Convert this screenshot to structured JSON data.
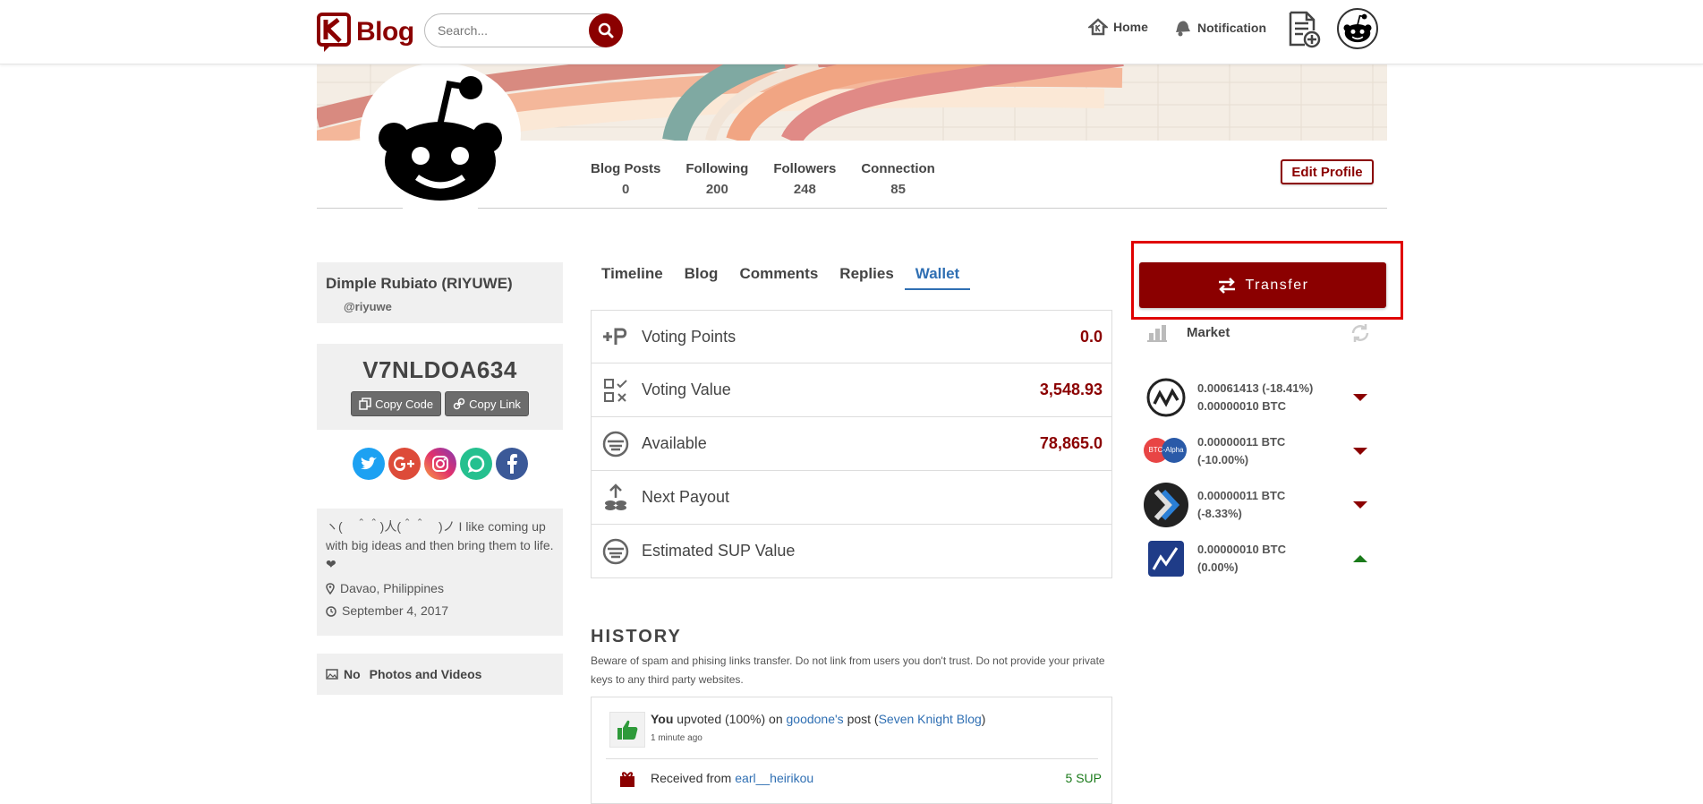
{
  "header": {
    "logo_text": "Blog",
    "search_placeholder": "Search...",
    "nav": [
      {
        "label": "Home",
        "icon": "home-icon"
      },
      {
        "label": "Notification",
        "icon": "bell-icon"
      }
    ]
  },
  "profile": {
    "stats": [
      {
        "label": "Blog Posts",
        "value": "0"
      },
      {
        "label": "Following",
        "value": "200"
      },
      {
        "label": "Followers",
        "value": "248"
      },
      {
        "label": "Connection",
        "value": "85"
      }
    ],
    "edit_label": "Edit Profile",
    "name": "Dimple Rubiato (RIYUWE)",
    "handle": "@riyuwe",
    "referral_code": "V7NLDOA634",
    "copy_code_label": "Copy Code",
    "copy_link_label": "Copy Link",
    "bio": "ヽ(　＾＾)人(＾＾　)ノ I like coming up with big ideas and then bring them to life. ❤",
    "location": "Davao, Philippines",
    "joined": "September 4, 2017",
    "photos_label_a": "No",
    "photos_label_b": "Photos and Videos"
  },
  "tabs": [
    {
      "label": "Timeline",
      "active": false
    },
    {
      "label": "Blog",
      "active": false
    },
    {
      "label": "Comments",
      "active": false
    },
    {
      "label": "Replies",
      "active": false
    },
    {
      "label": "Wallet",
      "active": true
    }
  ],
  "wallet": [
    {
      "label": "Voting Points",
      "value": "0.0"
    },
    {
      "label": "Voting Value",
      "value": "3,548.93"
    },
    {
      "label": "Available",
      "value": "78,865.0"
    },
    {
      "label": "Next Payout",
      "value": ""
    },
    {
      "label": "Estimated SUP Value",
      "value": ""
    }
  ],
  "history": {
    "title": "HISTORY",
    "note": "Beware of spam and phising links transfer. Do not link from users you don't trust. Do not provide your private keys to any third party websites.",
    "item1": {
      "actor": "You",
      "action": " upvoted (100%) on ",
      "user": "goodone's",
      "mid": " post (",
      "post": "Seven Knight Blog",
      "end": ")",
      "ago": "1 minute ago"
    },
    "item2": {
      "prefix": "Received from ",
      "user": "earl__heirikou",
      "amount": "5 SUP"
    }
  },
  "transfer_label": "Transfer",
  "market": {
    "title": "Market",
    "rows": [
      {
        "line1": "0.00061413 (-18.41%)",
        "line2": "0.00000010 BTC",
        "trend": "down"
      },
      {
        "line1": "0.00000011 BTC",
        "line2": "(-10.00%)",
        "trend": "down"
      },
      {
        "line1": "0.00000011 BTC",
        "line2": "(-8.33%)",
        "trend": "down"
      },
      {
        "line1": "0.00000010 BTC",
        "line2": "(0.00%)",
        "trend": "up"
      }
    ],
    "btc_alpha_label": "BTC-Alpha"
  },
  "colors": {
    "brand": "#8b0000",
    "link": "#2f6fb3",
    "highlight": "#e00000"
  }
}
